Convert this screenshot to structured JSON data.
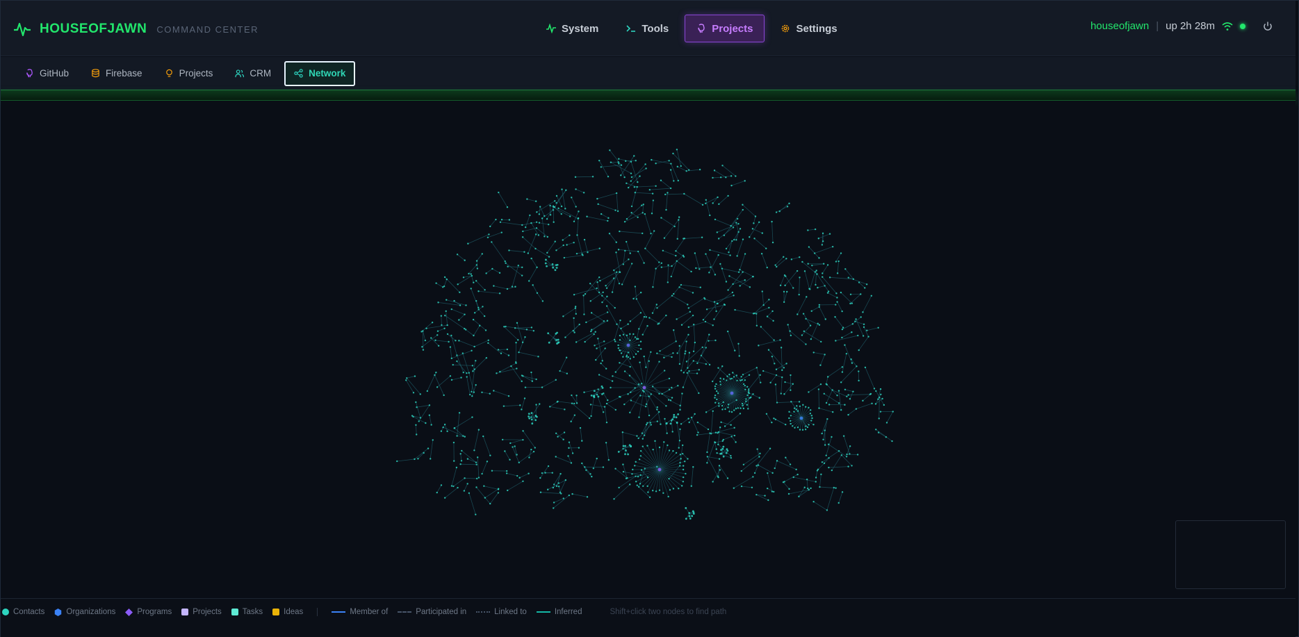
{
  "brand": {
    "name": "HOUSEOFJAWN",
    "subtitle": "COMMAND CENTER"
  },
  "main_nav": [
    {
      "label": "System",
      "icon": "activity-icon",
      "active": false
    },
    {
      "label": "Tools",
      "icon": "terminal-icon",
      "active": false
    },
    {
      "label": "Projects",
      "icon": "github-icon",
      "active": true
    },
    {
      "label": "Settings",
      "icon": "gear-icon",
      "active": false
    }
  ],
  "user": {
    "name": "houseofjawn",
    "uptime": "up 2h 28m"
  },
  "sub_nav": [
    {
      "label": "GitHub",
      "icon": "github-icon",
      "color": "#a855f7",
      "active": false
    },
    {
      "label": "Firebase",
      "icon": "database-icon",
      "color": "#f59e0b",
      "active": false
    },
    {
      "label": "Projects",
      "icon": "lightbulb-icon",
      "color": "#f59e0b",
      "active": false
    },
    {
      "label": "CRM",
      "icon": "users-icon",
      "color": "#2dd4bf",
      "active": false
    },
    {
      "label": "Network",
      "icon": "share-icon",
      "color": "#2dd4bf",
      "active": true
    }
  ],
  "legend": {
    "nodes": [
      {
        "label": "Contacts",
        "shape": "circle",
        "color": "#2dd4bf"
      },
      {
        "label": "Organizations",
        "shape": "hexagon",
        "color": "#3b82f6"
      },
      {
        "label": "Programs",
        "shape": "diamond",
        "color": "#8b5cf6"
      },
      {
        "label": "Projects",
        "shape": "square",
        "color": "#c4b5fd"
      },
      {
        "label": "Tasks",
        "shape": "square",
        "color": "#5eead4"
      },
      {
        "label": "Ideas",
        "shape": "square",
        "color": "#eab308"
      }
    ],
    "edges": [
      {
        "label": "Member of",
        "style": "solid",
        "color": "#3b82f6"
      },
      {
        "label": "Participated in",
        "style": "dashed",
        "color": "#475569"
      },
      {
        "label": "Linked to",
        "style": "dotted",
        "color": "#475569"
      },
      {
        "label": "Inferred",
        "style": "solid",
        "color": "#14b8a6"
      }
    ],
    "hint": "Shift+click two nodes to find path"
  },
  "colors": {
    "accent": "#22e66c",
    "active_tab": "#8b46d6",
    "node": "#2dd4bf",
    "edge": "#1f5f6a",
    "hub": "#8b5cf6"
  }
}
